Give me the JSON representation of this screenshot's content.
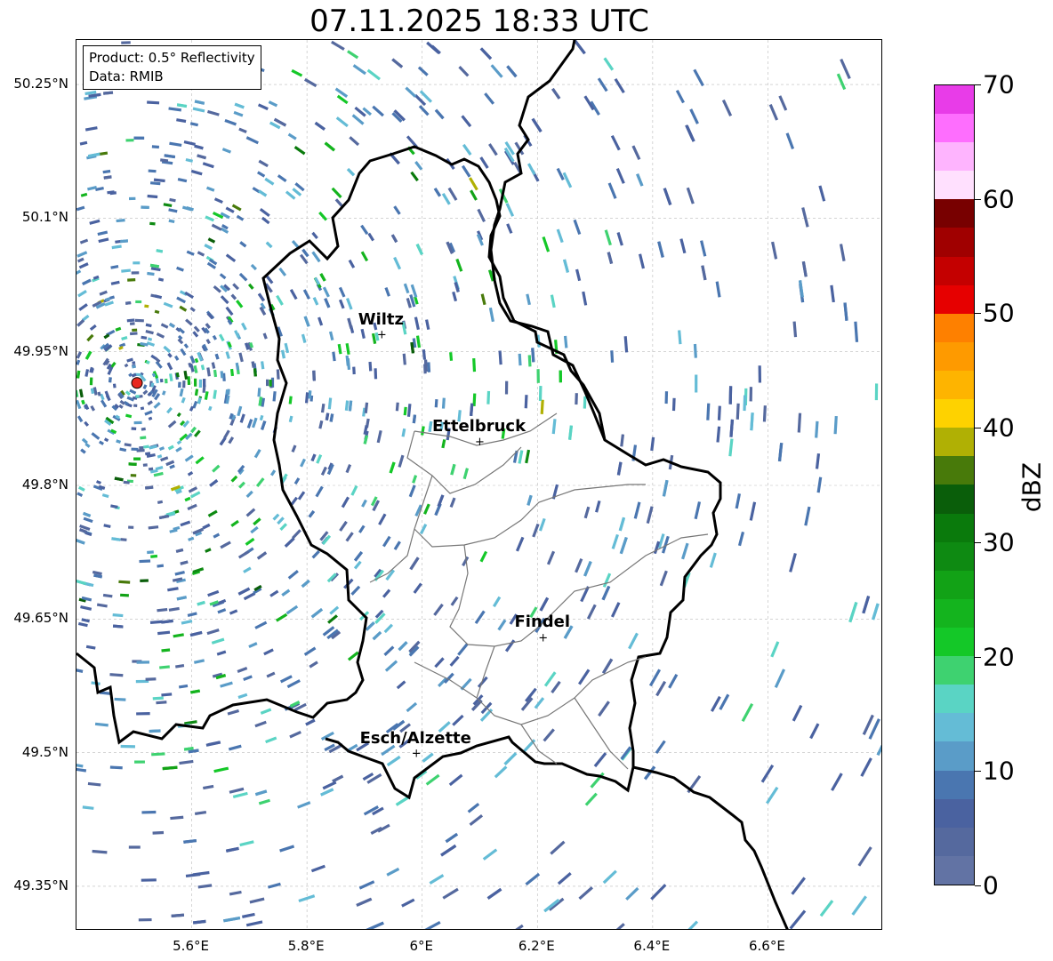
{
  "title": "07.11.2025 18:33 UTC",
  "info": {
    "product": "Product: 0.5° Reflectivity",
    "data": "Data: RMIB"
  },
  "map": {
    "lon_range": [
      5.4,
      6.8
    ],
    "lat_range": [
      49.3,
      50.3
    ],
    "lat_ticks": [
      {
        "value": 49.35,
        "label": "49.35°N"
      },
      {
        "value": 49.5,
        "label": "49.5°N"
      },
      {
        "value": 49.65,
        "label": "49.65°N"
      },
      {
        "value": 49.8,
        "label": "49.8°N"
      },
      {
        "value": 49.95,
        "label": "49.95°N"
      },
      {
        "value": 50.1,
        "label": "50.1°N"
      },
      {
        "value": 50.25,
        "label": "50.25°N"
      }
    ],
    "lon_ticks": [
      {
        "value": 5.6,
        "label": "5.6°E"
      },
      {
        "value": 5.8,
        "label": "5.8°E"
      },
      {
        "value": 6.0,
        "label": "6°E"
      },
      {
        "value": 6.2,
        "label": "6.2°E"
      },
      {
        "value": 6.4,
        "label": "6.4°E"
      },
      {
        "value": 6.6,
        "label": "6.6°E"
      }
    ],
    "cities": [
      {
        "name": "Wiltz",
        "lon": 5.93,
        "lat": 49.97
      },
      {
        "name": "Ettelbruck",
        "lon": 6.1,
        "lat": 49.85
      },
      {
        "name": "Findel",
        "lon": 6.21,
        "lat": 49.63
      },
      {
        "name": "Esch/Alzette",
        "lon": 5.99,
        "lat": 49.5
      }
    ],
    "radar_site": {
      "lon": 5.505,
      "lat": 49.915,
      "color": "#e8281e"
    }
  },
  "colorbar": {
    "unit": "dBZ",
    "min": 0,
    "max": 70,
    "tick_values": [
      0,
      10,
      20,
      30,
      40,
      50,
      60,
      70
    ],
    "tick_labels": [
      "0",
      "10",
      "20",
      "30",
      "40",
      "50",
      "60",
      "70"
    ],
    "colors": [
      "#6273a4",
      "#55699e",
      "#4a62a0",
      "#4a76b0",
      "#5a9cc8",
      "#64bcd6",
      "#5ad4c4",
      "#3ed270",
      "#14c828",
      "#14b41e",
      "#12a216",
      "#0e8a12",
      "#0a7a0c",
      "#0a5e0a",
      "#487a0a",
      "#b0b004",
      "#fed200",
      "#feb400",
      "#fe9a00",
      "#fe8000",
      "#e60000",
      "#c40000",
      "#a00000",
      "#780000",
      "#ffe0fe",
      "#feb4fe",
      "#fe6efe",
      "#e83ce8"
    ]
  }
}
